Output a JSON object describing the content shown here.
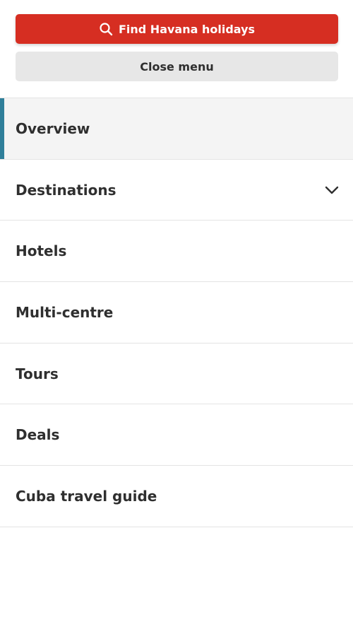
{
  "actions": {
    "find_label": "Find Havana holidays",
    "close_label": "Close menu"
  },
  "menu": {
    "items": [
      {
        "label": "Overview",
        "active": true
      },
      {
        "label": "Destinations",
        "has_submenu": true
      },
      {
        "label": "Hotels"
      },
      {
        "label": "Multi-centre"
      },
      {
        "label": "Tours"
      },
      {
        "label": "Deals"
      },
      {
        "label": "Cuba travel guide"
      }
    ]
  },
  "colors": {
    "primary": "#d62e22",
    "secondary_bg": "#e7e7e7",
    "active_accent": "#2f7f9a",
    "active_bg": "#f4f4f4",
    "divider": "#e4e4e4",
    "text": "#2f2f2f"
  },
  "icons": {
    "find": "search-icon",
    "destinations": "chevron-down-icon"
  }
}
